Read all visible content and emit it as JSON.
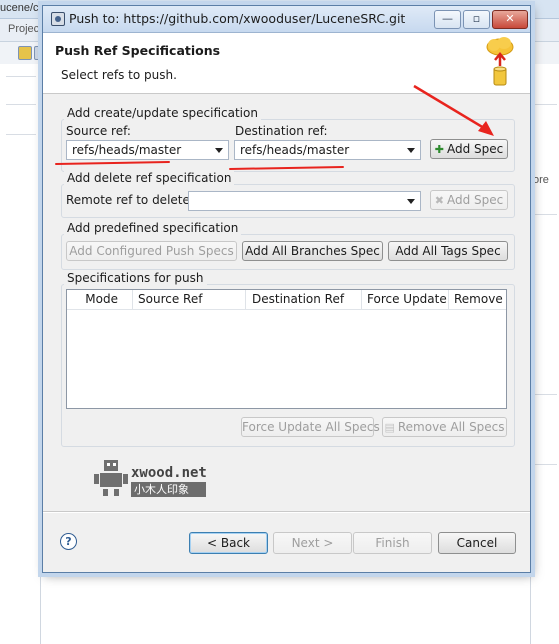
{
  "background": {
    "path_fragment": "ucene/cc",
    "tab_fragment": "Projec",
    "right_fragment": "ore"
  },
  "dialog": {
    "title": "Push to: https://github.com/xwooduser/LuceneSRC.git",
    "window_controls": {
      "minimize": "—",
      "maximize": "▫",
      "close": "✕"
    },
    "header": {
      "title": "Push Ref Specifications",
      "subtitle": "Select refs to push."
    },
    "create_update": {
      "group_label": "Add create/update specification",
      "source_label": "Source ref:",
      "source_value": "refs/heads/master",
      "destination_label": "Destination ref:",
      "destination_value": "refs/heads/master",
      "add_button": "Add Spec"
    },
    "delete": {
      "group_label": "Add delete ref specification",
      "remote_label": "Remote ref to delete:",
      "remote_value": "",
      "add_button": "Add Spec"
    },
    "predefined": {
      "group_label": "Add predefined specification",
      "buttons": [
        "Add Configured Push Specs",
        "Add All Branches Spec",
        "Add All Tags Spec"
      ]
    },
    "specs": {
      "group_label": "Specifications for push",
      "columns": [
        "Mode",
        "Source Ref",
        "Destination Ref",
        "Force Update",
        "Remove"
      ],
      "rows": [],
      "force_update_all": "Force Update All Specs",
      "remove_all": "Remove All Specs"
    },
    "watermark": {
      "brand": "xwood.net",
      "caption": "小木人印象"
    },
    "footer": {
      "help_icon": "?",
      "back": "< Back",
      "next": "Next >",
      "finish": "Finish",
      "cancel": "Cancel"
    }
  }
}
